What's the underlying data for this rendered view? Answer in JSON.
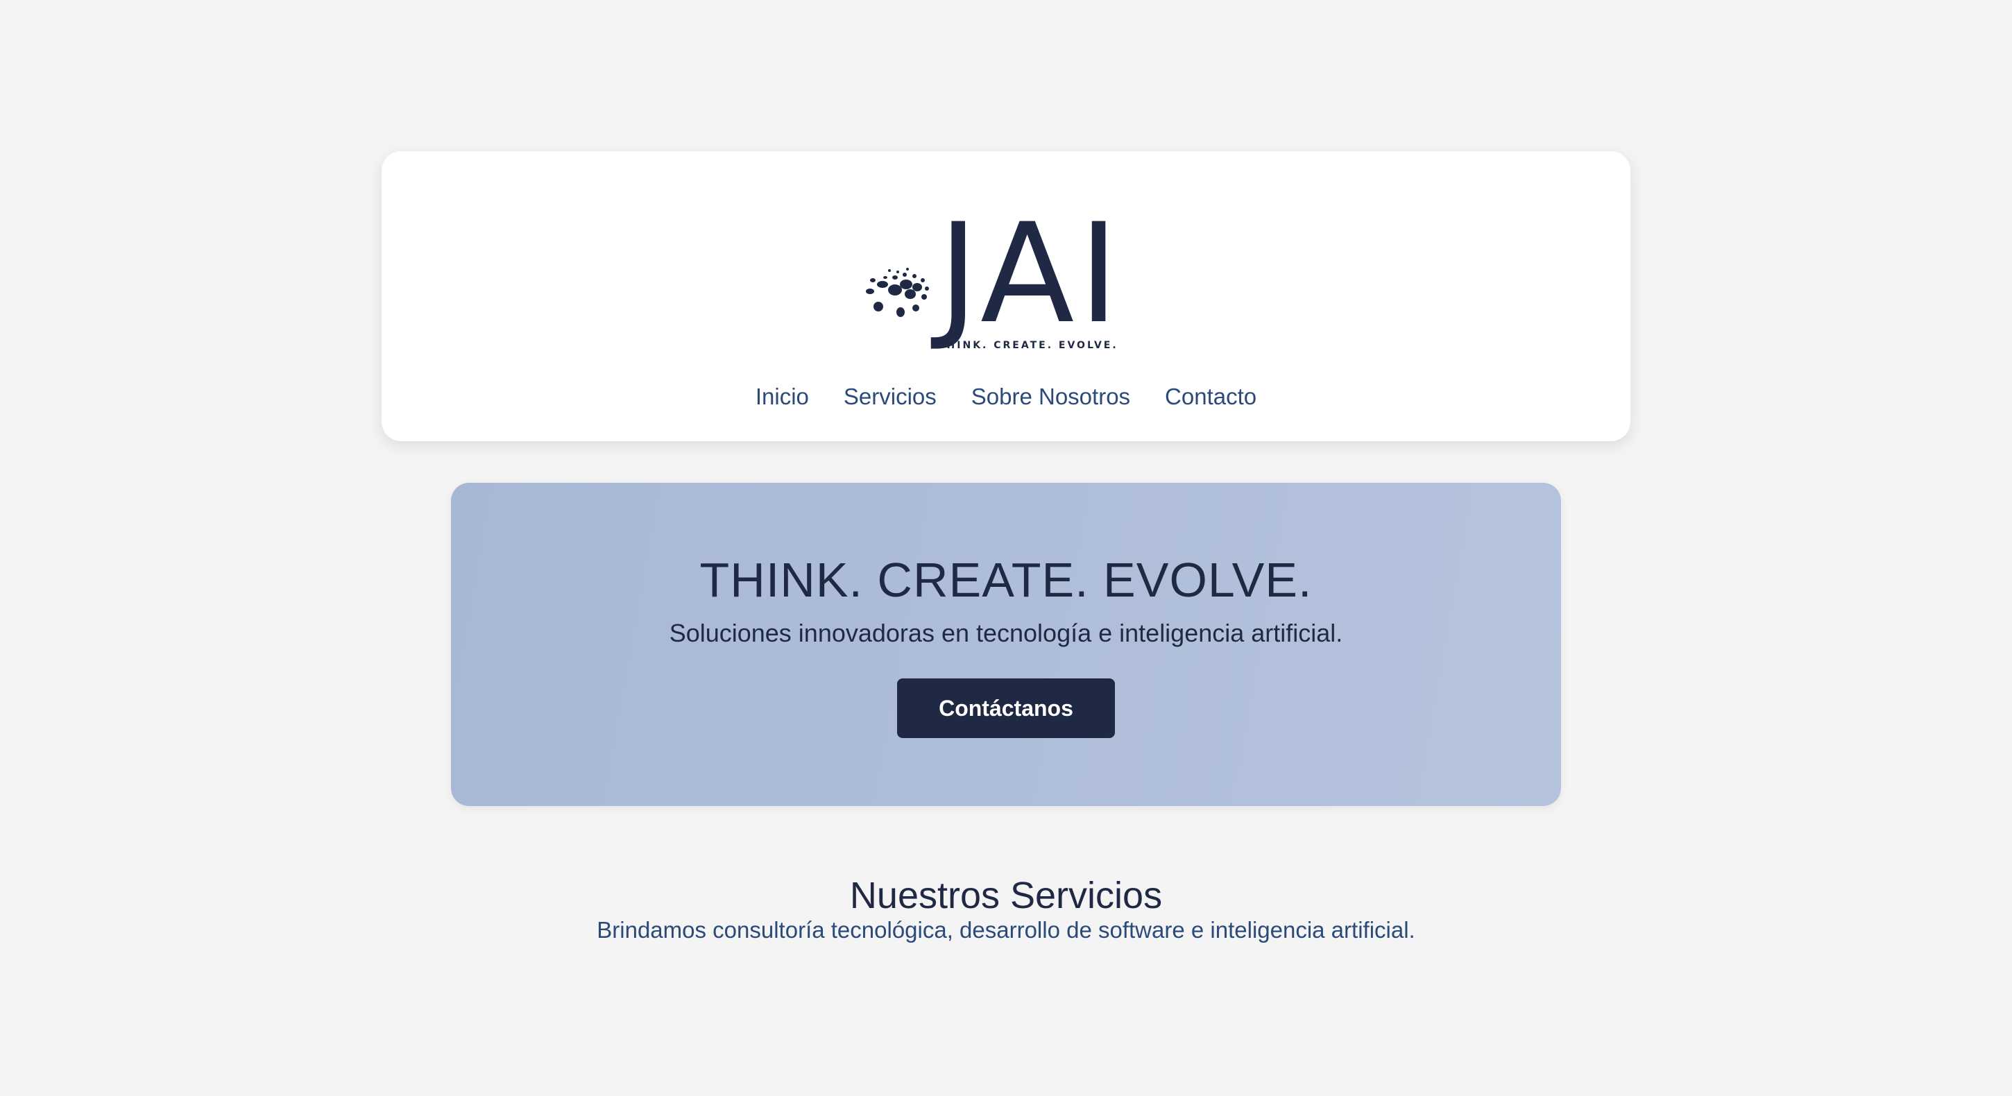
{
  "brand": {
    "logo_text": "JAI",
    "logo_tagline": "THINK. CREATE. EVOLVE.",
    "logo_icon": "dots-sphere-icon",
    "color": "#1f2944"
  },
  "nav": {
    "items": [
      {
        "label": "Inicio"
      },
      {
        "label": "Servicios"
      },
      {
        "label": "Sobre Nosotros"
      },
      {
        "label": "Contacto"
      }
    ],
    "color": "#2b4a7a"
  },
  "hero": {
    "title": "THINK. CREATE. EVOLVE.",
    "subtitle": "Soluciones innovadoras en tecnología e inteligencia artificial.",
    "cta_label": "Contáctanos",
    "background": "#aebdd9",
    "button_color": "#1f2944"
  },
  "services": {
    "title": "Nuestros Servicios",
    "description": "Brindamos consultoría tecnológica, desarrollo de software e inteligencia artificial."
  },
  "page": {
    "background": "#f4f4f4"
  }
}
